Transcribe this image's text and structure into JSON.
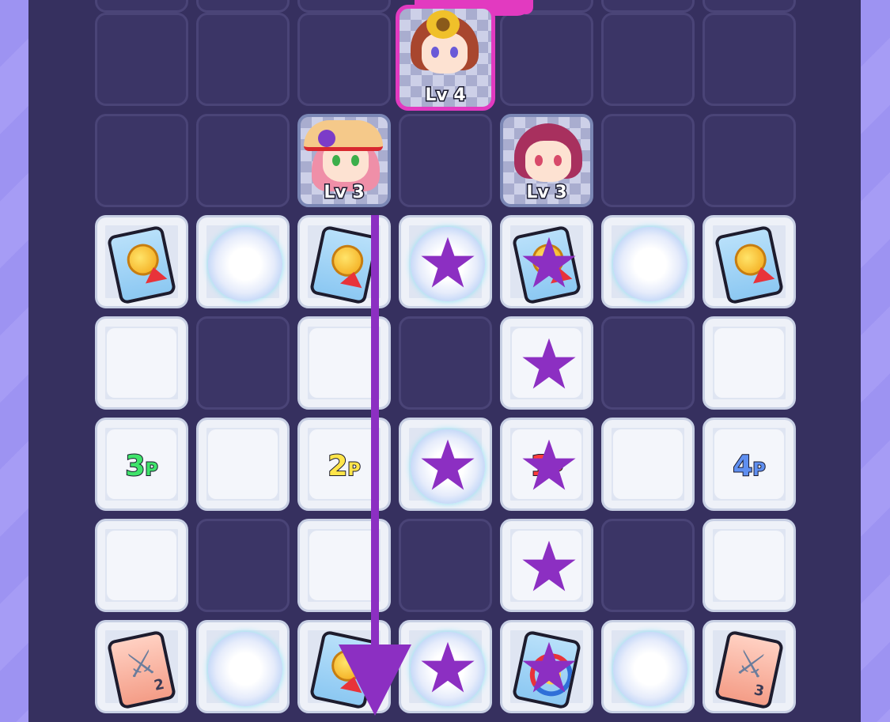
{
  "colors": {
    "board": "#36305f",
    "side": "#9a8ff0",
    "star": "#8c2fc2",
    "arrow": "#8c2fc2",
    "leader_frame": "#e23ac0",
    "p3": "#3fe36a",
    "p2": "#ffe54a",
    "p1": "#ff3b3b",
    "p4": "#5f8ff0"
  },
  "characters": [
    {
      "id": "leader",
      "level": "Lv 4",
      "hair": "#a8462e",
      "eyes": "#6a5ad8",
      "accessory": "sunflower"
    },
    {
      "id": "hat-girl",
      "level": "Lv 3",
      "hair": "#ef8fa8",
      "eyes": "#3cae4a",
      "accessory": "rose-hat"
    },
    {
      "id": "ponytail-girl",
      "level": "Lv 3",
      "hair": "#a8305e",
      "eyes": "#d84a6a",
      "accessory": "none"
    }
  ],
  "tiles": {
    "row_top_items": [
      "medal-card",
      "orb",
      "medal-card",
      "orb-star",
      "medal-card-star",
      "orb",
      "medal-card"
    ],
    "player_labels": [
      {
        "num": "3",
        "suffix": "P",
        "color": "#3fe36a"
      },
      {
        "num": "2",
        "suffix": "P",
        "color": "#ffe54a"
      },
      {
        "num": "1",
        "suffix": "P",
        "color": "#ff3b3b"
      },
      {
        "num": "4",
        "suffix": "P",
        "color": "#5f8ff0"
      }
    ],
    "row_bottom_items": [
      "sword-card-2",
      "orb",
      "medal-card",
      "orb-star",
      "cycle-card-star",
      "orb",
      "sword-card-3"
    ],
    "sword_values": [
      "2",
      "3"
    ]
  },
  "icons": {
    "star": "star-icon",
    "arrow": "arrow-down-icon",
    "medal": "medal-card-icon",
    "sword": "sword-card-icon",
    "cycle": "cycle-card-icon",
    "orb": "glow-orb-icon"
  }
}
